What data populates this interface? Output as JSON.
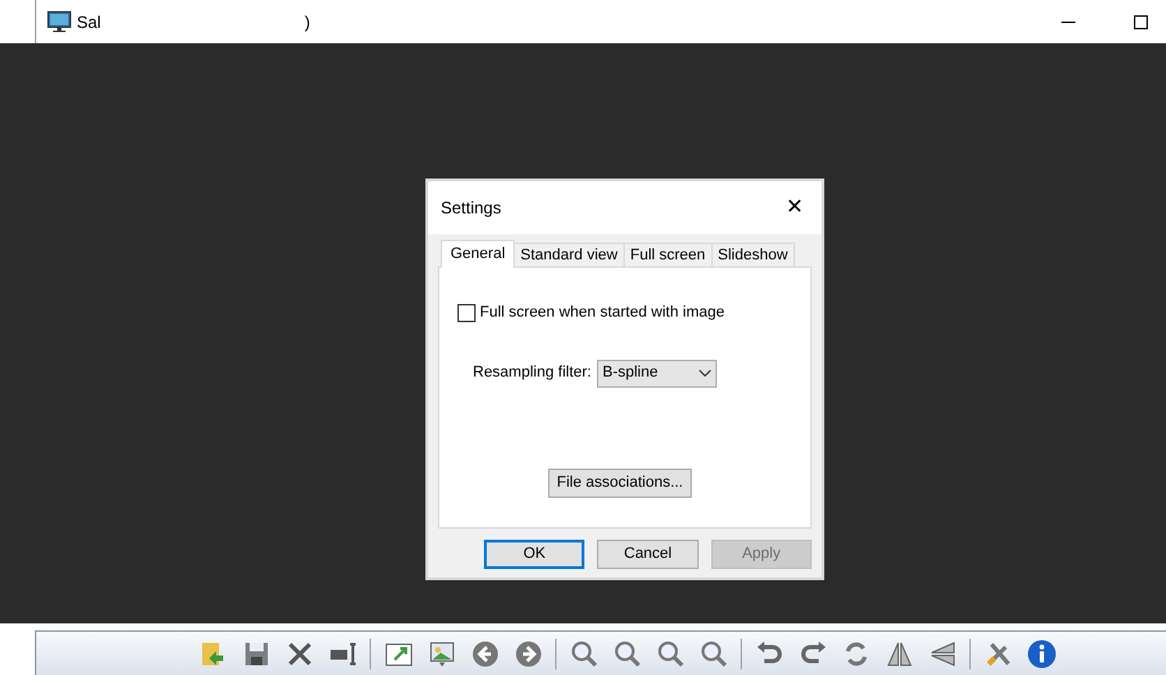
{
  "window": {
    "title": "Sal",
    "title_tail": ")"
  },
  "dialog": {
    "title": "Settings",
    "close": "✕",
    "tabs": [
      {
        "label": "General",
        "selected": true
      },
      {
        "label": "Standard view",
        "selected": false
      },
      {
        "label": "Full screen",
        "selected": false
      },
      {
        "label": "Slideshow",
        "selected": false
      }
    ],
    "checkbox": {
      "label": "Full screen when started with image",
      "checked": false
    },
    "resampling": {
      "label": "Resampling filter:",
      "value": "B-spline"
    },
    "file_associations": "File associations...",
    "buttons": [
      {
        "label": "OK",
        "default": true,
        "disabled": false
      },
      {
        "label": "Cancel",
        "default": false,
        "disabled": false
      },
      {
        "label": "Apply",
        "default": false,
        "disabled": true
      }
    ]
  }
}
